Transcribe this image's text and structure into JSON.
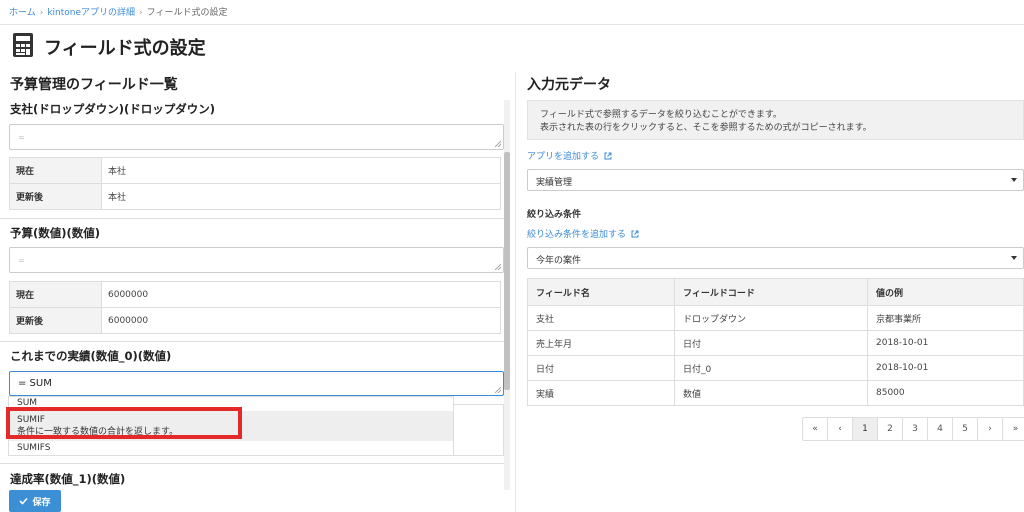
{
  "breadcrumb": {
    "home": "ホーム",
    "app_detail": "kintoneアプリの詳細",
    "current": "フィールド式の設定"
  },
  "page": {
    "title": "フィールド式の設定",
    "icon": "calculator-icon"
  },
  "left": {
    "title": "予算管理のフィールド一覧",
    "fields": [
      {
        "label": "支社(ドロップダウン)(ドロップダウン)",
        "placeholder": "=",
        "rows": [
          {
            "key": "現在",
            "value": "本社"
          },
          {
            "key": "更新後",
            "value": "本社"
          }
        ]
      },
      {
        "label": "予算(数値)(数値)",
        "placeholder": "=",
        "rows": [
          {
            "key": "現在",
            "value": "6000000"
          },
          {
            "key": "更新後",
            "value": "6000000"
          }
        ]
      },
      {
        "label": "これまでの実績(数値_0)(数値)",
        "value": "= SUM"
      },
      {
        "label": "達成率(数値_1)(数値)"
      }
    ],
    "autocomplete": [
      {
        "name": "SUM"
      },
      {
        "name": "SUMIF",
        "desc": "条件に一致する数値の合計を返します。"
      },
      {
        "name": "SUMIFS"
      }
    ],
    "save_label": "保存"
  },
  "right": {
    "title": "入力元データ",
    "info_line1": "フィールド式で参照するデータを絞り込むことができます。",
    "info_line2": "表示された表の行をクリックすると、そこを参照するための式がコピーされます。",
    "add_app_link": "アプリを追加する",
    "app_select": "実績管理",
    "filter_label": "絞り込み条件",
    "add_filter_link": "絞り込み条件を追加する",
    "filter_select": "今年の案件",
    "table": {
      "headers": [
        "フィールド名",
        "フィールドコード",
        "値の例"
      ],
      "rows": [
        [
          "支社",
          "ドロップダウン",
          "京都事業所"
        ],
        [
          "売上年月",
          "日付",
          "2018-10-01"
        ],
        [
          "日付",
          "日付_0",
          "2018-10-01"
        ],
        [
          "実績",
          "数値",
          "85000"
        ]
      ]
    },
    "pager": [
      "«",
      "‹",
      "1",
      "2",
      "3",
      "4",
      "5",
      "›",
      "»"
    ],
    "pager_active": "1"
  },
  "colors": {
    "accent": "#3b8bd6",
    "button": "#3d8fd5",
    "highlight_box": "#e3292a"
  }
}
